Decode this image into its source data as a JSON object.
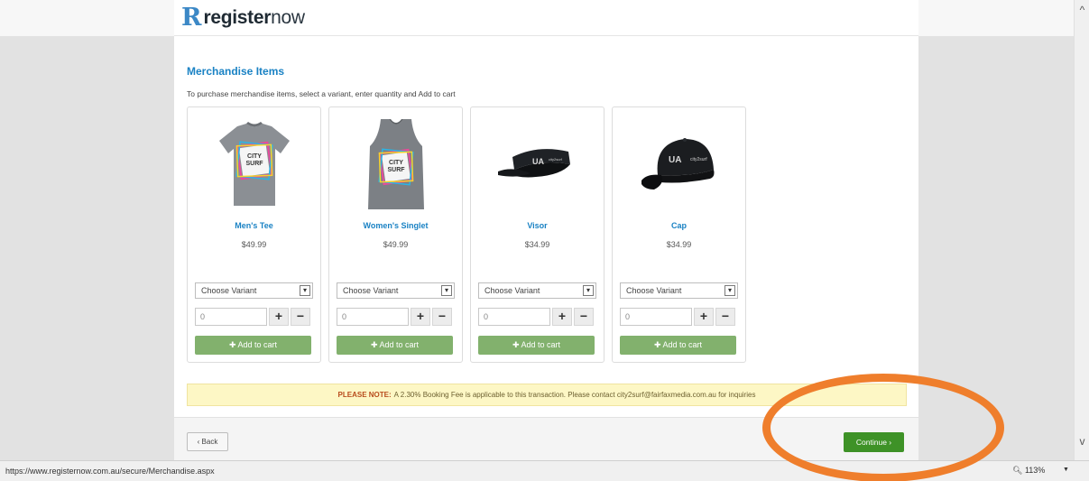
{
  "brand": {
    "logo_mark": "R",
    "logo_bold": "register",
    "logo_light": "now"
  },
  "page": {
    "title": "Merchandise Items",
    "instructions": "To purchase merchandise items, select a variant, enter quantity and Add to cart"
  },
  "products": [
    {
      "name": "Men's Tee",
      "price": "$49.99",
      "variant_placeholder": "Choose Variant",
      "quantity": "0",
      "add_label": "Add to cart",
      "image_icon": "tshirt-icon"
    },
    {
      "name": "Women's Singlet",
      "price": "$49.99",
      "variant_placeholder": "Choose Variant",
      "quantity": "0",
      "add_label": "Add to cart",
      "image_icon": "singlet-icon"
    },
    {
      "name": "Visor",
      "price": "$34.99",
      "variant_placeholder": "Choose Variant",
      "quantity": "0",
      "add_label": "Add to cart",
      "image_icon": "visor-icon"
    },
    {
      "name": "Cap",
      "price": "$34.99",
      "variant_placeholder": "Choose Variant",
      "quantity": "0",
      "add_label": "Add to cart",
      "image_icon": "cap-icon"
    }
  ],
  "notice": {
    "label": "PLEASE NOTE:",
    "text": "A 2.30% Booking Fee is applicable to this transaction. Please contact city2surf@fairfaxmedia.com.au for inquiries"
  },
  "footer": {
    "back_label": "‹ Back",
    "continue_label": "Continue ›"
  },
  "statusbar": {
    "url": "https://www.registernow.com.au/secure/Merchandise.aspx",
    "zoom": "113%"
  },
  "colors": {
    "link_blue": "#1a82c4",
    "add_green": "#82b16d",
    "continue_green": "#3e9227",
    "annotation_orange": "#ef7e2c",
    "notice_yellow": "#fdf7c5"
  }
}
